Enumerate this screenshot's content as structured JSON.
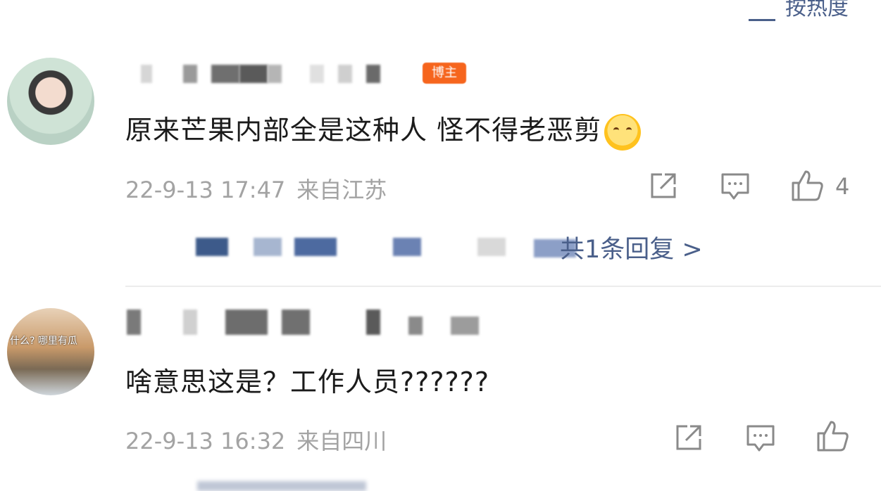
{
  "header": {
    "sort_label": "按热度"
  },
  "comments": [
    {
      "content": "原来芒果内部全是这种人 怪不得老恶剪",
      "badge": "博主",
      "time": "22-9-13 17:47",
      "location": "来自江苏",
      "likes": "4",
      "reply_link": "共1条回复 >",
      "emoji": "grinning-face-emoji"
    },
    {
      "content": "啥意思这是？工作人员??????",
      "avatar_text": "什么? 哪里有瓜",
      "time": "22-9-13 16:32",
      "location": "来自四川"
    }
  ],
  "icons": {
    "share": "share-icon",
    "comment": "comment-icon",
    "like": "thumbs-up-icon",
    "sort": "sort-icon"
  },
  "colors": {
    "link": "#4a5f8a",
    "meta": "#a3a3a3",
    "badge": "#f6651d"
  }
}
